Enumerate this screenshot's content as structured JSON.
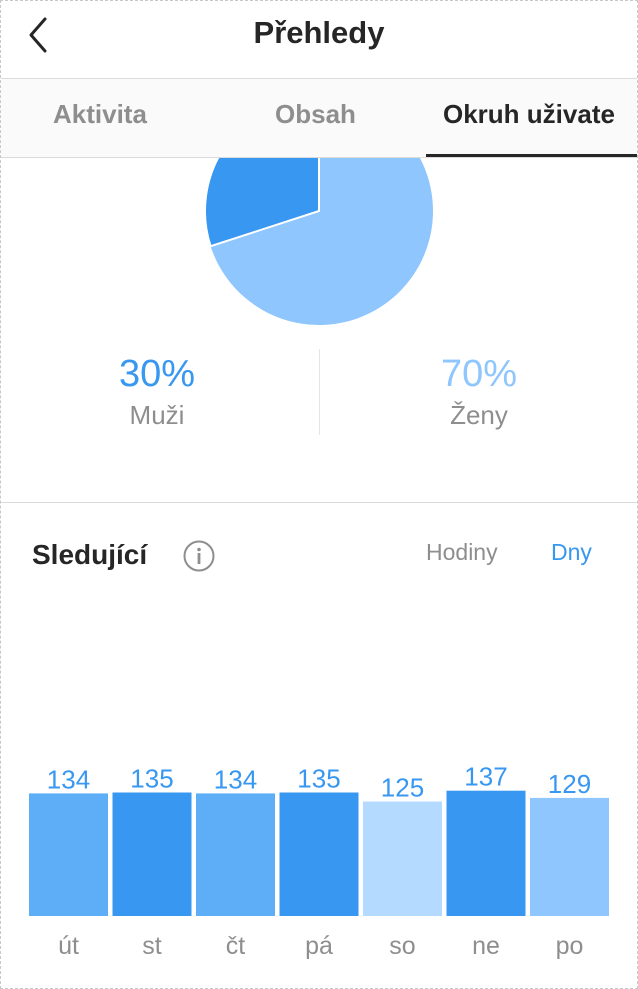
{
  "header": {
    "title": "Přehledy"
  },
  "tabs": [
    {
      "label": "Aktivita",
      "active": false
    },
    {
      "label": "Obsah",
      "active": false
    },
    {
      "label": "Okruh uživate",
      "active": true
    }
  ],
  "gender": {
    "men": {
      "percent": "30%",
      "label": "Muži",
      "color": "#3897f0",
      "fraction": 0.3
    },
    "women": {
      "percent": "70%",
      "label": "Ženy",
      "color": "#8ec6fd",
      "fraction": 0.7
    }
  },
  "followers": {
    "title": "Sledující",
    "toggle_hours": "Hodiny",
    "toggle_days": "Dny",
    "selected_toggle": "Dny"
  },
  "colors": {
    "accent": "#3897f0",
    "bar_dark": "#3897f0",
    "bar_mid": "#5eadf7",
    "bar_light": "#8ec6fd",
    "bar_lightest": "#b5daff",
    "text": "#262626",
    "muted": "#8e8e8e"
  },
  "chart_data": {
    "type": "bar",
    "categories": [
      "út",
      "st",
      "čt",
      "pá",
      "so",
      "ne",
      "po"
    ],
    "values": [
      134,
      135,
      134,
      135,
      125,
      137,
      129
    ],
    "bar_colors": [
      "#5eadf7",
      "#3897f0",
      "#5eadf7",
      "#3897f0",
      "#b5daff",
      "#3897f0",
      "#8ec6fd"
    ],
    "data_labels": true,
    "grid": false,
    "legend": "none"
  }
}
